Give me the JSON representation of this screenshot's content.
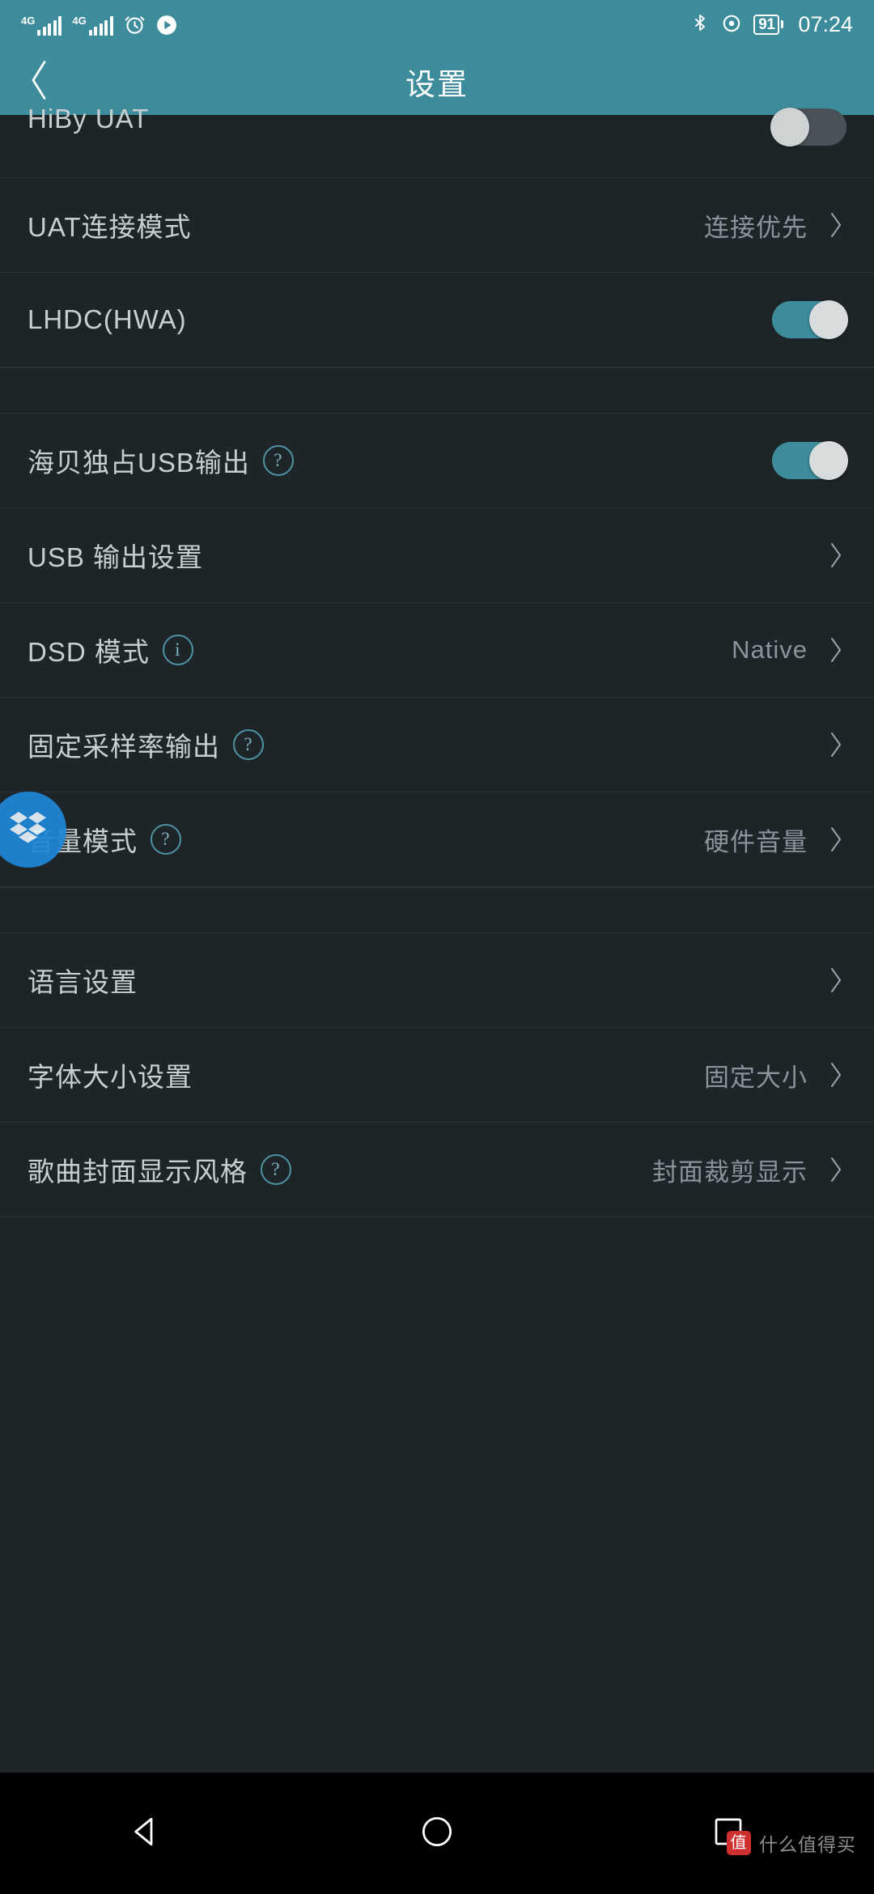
{
  "status_bar": {
    "network_1": "4G",
    "network_2": "4G",
    "icons": [
      "signal-4g-icon",
      "signal-4g-icon",
      "alarm-clock-icon",
      "play-icon",
      "bluetooth-icon",
      "location-icon",
      "battery-icon"
    ],
    "battery_level": "91",
    "time": "07:24"
  },
  "header": {
    "title": "设置",
    "back_icon": "chevron-left-icon"
  },
  "groups": [
    {
      "rows": [
        {
          "label": "HiBy UAT",
          "type": "toggle",
          "toggle": "off",
          "clipped": true
        },
        {
          "label": "UAT连接模式",
          "type": "nav",
          "value": "连接优先"
        },
        {
          "label": "LHDC(HWA)",
          "type": "toggle",
          "toggle": "on"
        }
      ]
    },
    {
      "rows": [
        {
          "label": "海贝独占USB输出",
          "type": "toggle",
          "toggle": "on",
          "hint": "?"
        },
        {
          "label": "USB 输出设置",
          "type": "nav",
          "value": ""
        },
        {
          "label": "DSD 模式",
          "type": "nav",
          "value": "Native",
          "hint": "i"
        },
        {
          "label": "固定采样率输出",
          "type": "nav",
          "value": "",
          "hint": "?"
        },
        {
          "label": "音量模式",
          "type": "nav",
          "value": "硬件音量",
          "hint": "?"
        }
      ]
    },
    {
      "rows": [
        {
          "label": "语言设置",
          "type": "nav",
          "value": ""
        },
        {
          "label": "字体大小设置",
          "type": "nav",
          "value": "固定大小"
        },
        {
          "label": "歌曲封面显示风格",
          "type": "nav",
          "value": "封面裁剪显示",
          "hint": "?"
        }
      ]
    }
  ],
  "float_badge": {
    "name": "dropbox-icon"
  },
  "nav_bar": {
    "back": "back-triangle-icon",
    "home": "home-circle-icon",
    "recents": "recents-square-icon"
  },
  "watermark": {
    "logo": "值",
    "text": "什么值得买"
  },
  "colors": {
    "accent": "#3d8c9b",
    "background": "#1d2529",
    "divider": "#2b3337",
    "label": "#c9ced1",
    "value": "#8b9499",
    "badge": "#1f87d8"
  }
}
